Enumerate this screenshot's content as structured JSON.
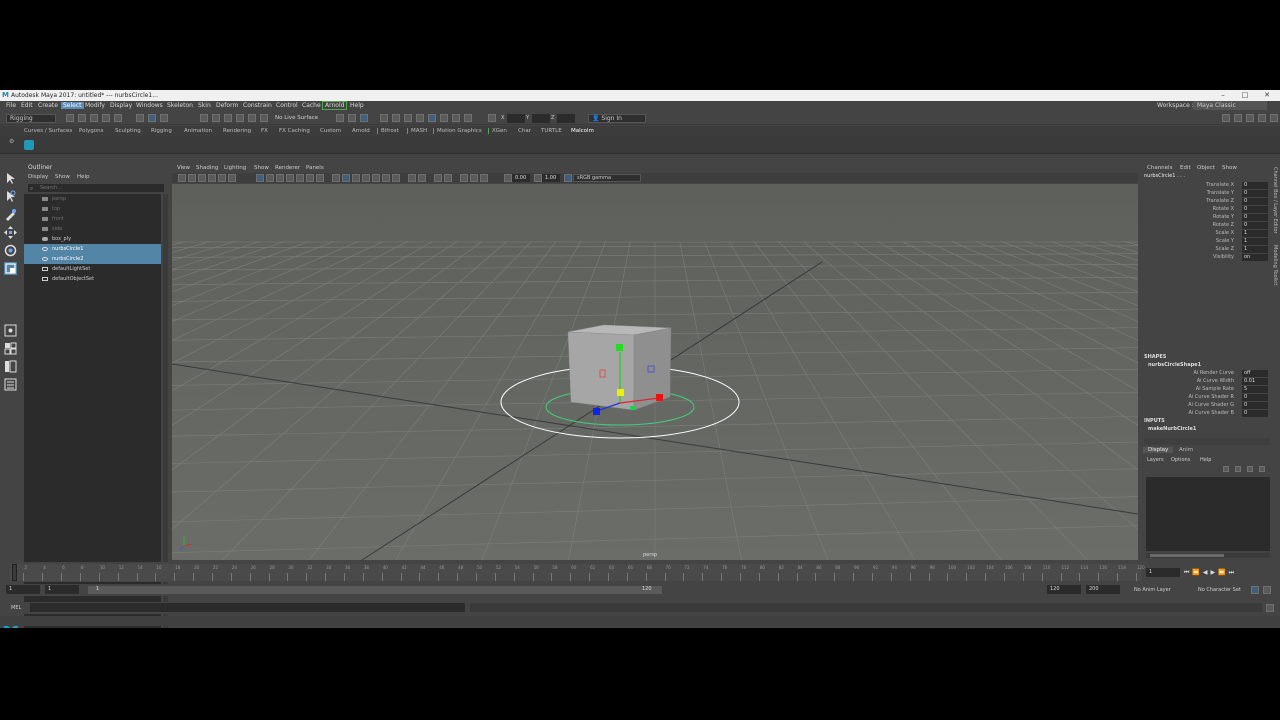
{
  "window": {
    "title": "Autodesk Maya 2017: untitled*   ---   nurbsCircle1..."
  },
  "menubar": {
    "items": [
      "File",
      "Edit",
      "Create",
      "Select",
      "Modify",
      "Display",
      "Windows",
      "Skeleton",
      "Skin",
      "Deform",
      "Constrain",
      "Control",
      "Cache",
      "Arnold",
      "Help"
    ],
    "workspace_label": "Workspace :",
    "workspace_value": "Maya Classic"
  },
  "statusline": {
    "menuset": "Rigging",
    "live_surface": "No Live Surface",
    "field1": "X",
    "field2": "Y",
    "field3": "Z",
    "sign_in": "Sign In"
  },
  "shelf_tabs": [
    "Curves / Surfaces",
    "Polygons",
    "Sculpting",
    "Rigging",
    "Animation",
    "Rendering",
    "FX",
    "FX Caching",
    "Custom",
    "Arnold",
    "Bifrost",
    "MASH",
    "Motion Graphics",
    "XGen",
    "Char",
    "TURTLE",
    "Malcolm"
  ],
  "outliner": {
    "title": "Outliner",
    "menu": [
      "Display",
      "Show",
      "Help"
    ],
    "search_placeholder": "Search...",
    "rows": [
      {
        "label": "persp",
        "state": "dim"
      },
      {
        "label": "top",
        "state": "dim"
      },
      {
        "label": "front",
        "state": "dim"
      },
      {
        "label": "side",
        "state": "dim"
      },
      {
        "label": "box_ply",
        "state": "normal"
      },
      {
        "label": "nurbsCircle1",
        "state": "sel"
      },
      {
        "label": "nurbsCircle2",
        "state": "sel"
      },
      {
        "label": "defaultLightSet",
        "state": "normal"
      },
      {
        "label": "defaultObjectSet",
        "state": "normal"
      }
    ]
  },
  "viewport": {
    "menu": [
      "View",
      "Shading",
      "Lighting",
      "Show",
      "Renderer",
      "Panels"
    ],
    "exposure": "0.00",
    "gamma": "1.00",
    "colorspace": "sRGB gamma",
    "camera_label": "persp"
  },
  "channelbox": {
    "menu": [
      "Channels",
      "Edit",
      "Object",
      "Show"
    ],
    "object_name": "nurbsCircle1 . . .",
    "channels": [
      {
        "label": "Translate X",
        "value": "0"
      },
      {
        "label": "Translate Y",
        "value": "0"
      },
      {
        "label": "Translate Z",
        "value": "0"
      },
      {
        "label": "Rotate X",
        "value": "0"
      },
      {
        "label": "Rotate Y",
        "value": "0"
      },
      {
        "label": "Rotate Z",
        "value": "0"
      },
      {
        "label": "Scale X",
        "value": "1"
      },
      {
        "label": "Scale Y",
        "value": "1"
      },
      {
        "label": "Scale Z",
        "value": "1"
      },
      {
        "label": "Visibility",
        "value": "on"
      }
    ],
    "shapes_header": "SHAPES",
    "shape_name": "nurbsCircleShape1",
    "shape_channels": [
      {
        "label": "Ai Render Curve",
        "value": "off"
      },
      {
        "label": "Ai Curve Width",
        "value": "0.01"
      },
      {
        "label": "Ai Sample Rate",
        "value": "5"
      },
      {
        "label": "Ai Curve Shader R",
        "value": "0"
      },
      {
        "label": "Ai Curve Shader G",
        "value": "0"
      },
      {
        "label": "Ai Curve Shader B",
        "value": "0"
      }
    ],
    "inputs_header": "INPUTS",
    "input_name": "makeNurbCircle1",
    "side_tabs": [
      "Channel Box / Layer Editor",
      "Modeling Toolkit"
    ]
  },
  "layers": {
    "tabs": [
      "Display",
      "Anim"
    ],
    "menu": [
      "Layers",
      "Options",
      "Help"
    ]
  },
  "timeslider": {
    "ticks": [
      "1",
      "2",
      "4",
      "6",
      "8",
      "10",
      "12",
      "14",
      "16",
      "18",
      "20",
      "22",
      "24",
      "26",
      "28",
      "30",
      "32",
      "34",
      "36",
      "38",
      "40",
      "42",
      "44",
      "46",
      "48",
      "50",
      "52",
      "54",
      "56",
      "58",
      "60",
      "62",
      "64",
      "66",
      "68",
      "70",
      "72",
      "74",
      "76",
      "78",
      "80",
      "82",
      "84",
      "86",
      "88",
      "90",
      "92",
      "94",
      "96",
      "98",
      "100",
      "102",
      "104",
      "106",
      "108",
      "110",
      "112",
      "114",
      "116",
      "118",
      "120"
    ],
    "current_frame": "1"
  },
  "rangebar": {
    "start": "1",
    "inner_start": "1",
    "bar_start": "1",
    "bar_end": "120",
    "end": "120",
    "outer_end": "200",
    "anim_layer": "No Anim Layer",
    "char_set": "No Character Set"
  },
  "cmdline": {
    "label": "MEL"
  }
}
